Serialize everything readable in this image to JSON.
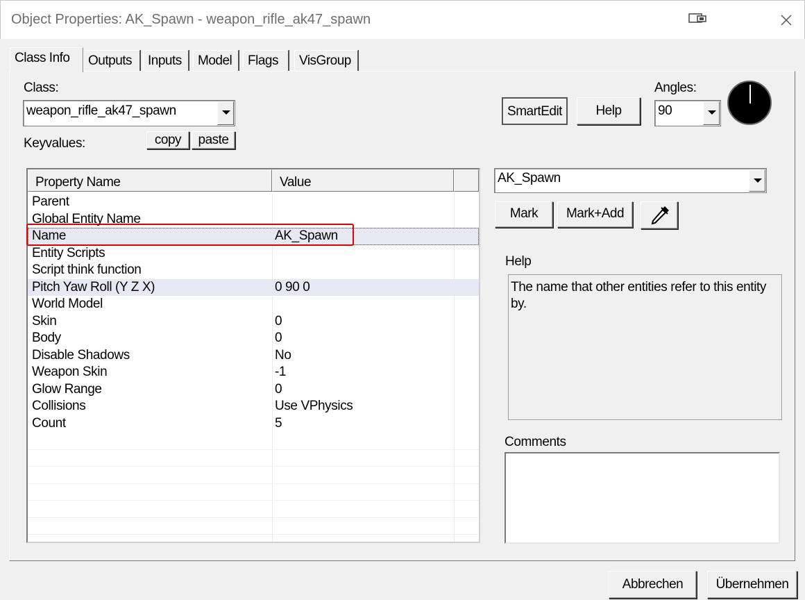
{
  "window": {
    "title": "Object Properties: AK_Spawn - weapon_rifle_ak47_spawn",
    "icons": [
      "restore-icon",
      "close-icon"
    ]
  },
  "tabs": [
    "Class Info",
    "Outputs",
    "Inputs",
    "Model",
    "Flags",
    "VisGroup"
  ],
  "active_tab": "Class Info",
  "class_section": {
    "class_label": "Class:",
    "class_value": "weapon_rifle_ak47_spawn",
    "keyvalues_label": "Keyvalues:",
    "copy_label": "copy",
    "paste_label": "paste"
  },
  "toolbar": {
    "smartedit_label": "SmartEdit",
    "help_label": "Help",
    "angles_label": "Angles:",
    "angles_value": "90"
  },
  "table": {
    "headers": [
      "Property Name",
      "Value"
    ],
    "rows": [
      {
        "name": "Parent",
        "value": ""
      },
      {
        "name": "Global Entity Name",
        "value": ""
      },
      {
        "name": "Name",
        "value": "AK_Spawn"
      },
      {
        "name": "Entity Scripts",
        "value": ""
      },
      {
        "name": "Script think function",
        "value": ""
      },
      {
        "name": "Pitch Yaw Roll (Y Z X)",
        "value": "0 90 0"
      },
      {
        "name": "World Model",
        "value": ""
      },
      {
        "name": "Skin",
        "value": "0"
      },
      {
        "name": "Body",
        "value": "0"
      },
      {
        "name": "Disable Shadows",
        "value": "No"
      },
      {
        "name": "Weapon Skin",
        "value": "-1"
      },
      {
        "name": "Glow Range",
        "value": "0"
      },
      {
        "name": "Collisions",
        "value": "Use VPhysics"
      },
      {
        "name": "Count",
        "value": "5"
      }
    ],
    "selected_row": "Name"
  },
  "right_panel": {
    "value_combo": "AK_Spawn",
    "mark_label": "Mark",
    "mark_add_label": "Mark+Add",
    "help_heading": "Help",
    "help_text": "The name that other entities refer to this entity by.",
    "comments_heading": "Comments",
    "comments_text": ""
  },
  "footer": {
    "cancel_label": "Abbrechen",
    "apply_label": "Übernehmen"
  },
  "colors": {
    "highlight_box": "#e00000",
    "shaded_row": "#e8e8f4"
  }
}
